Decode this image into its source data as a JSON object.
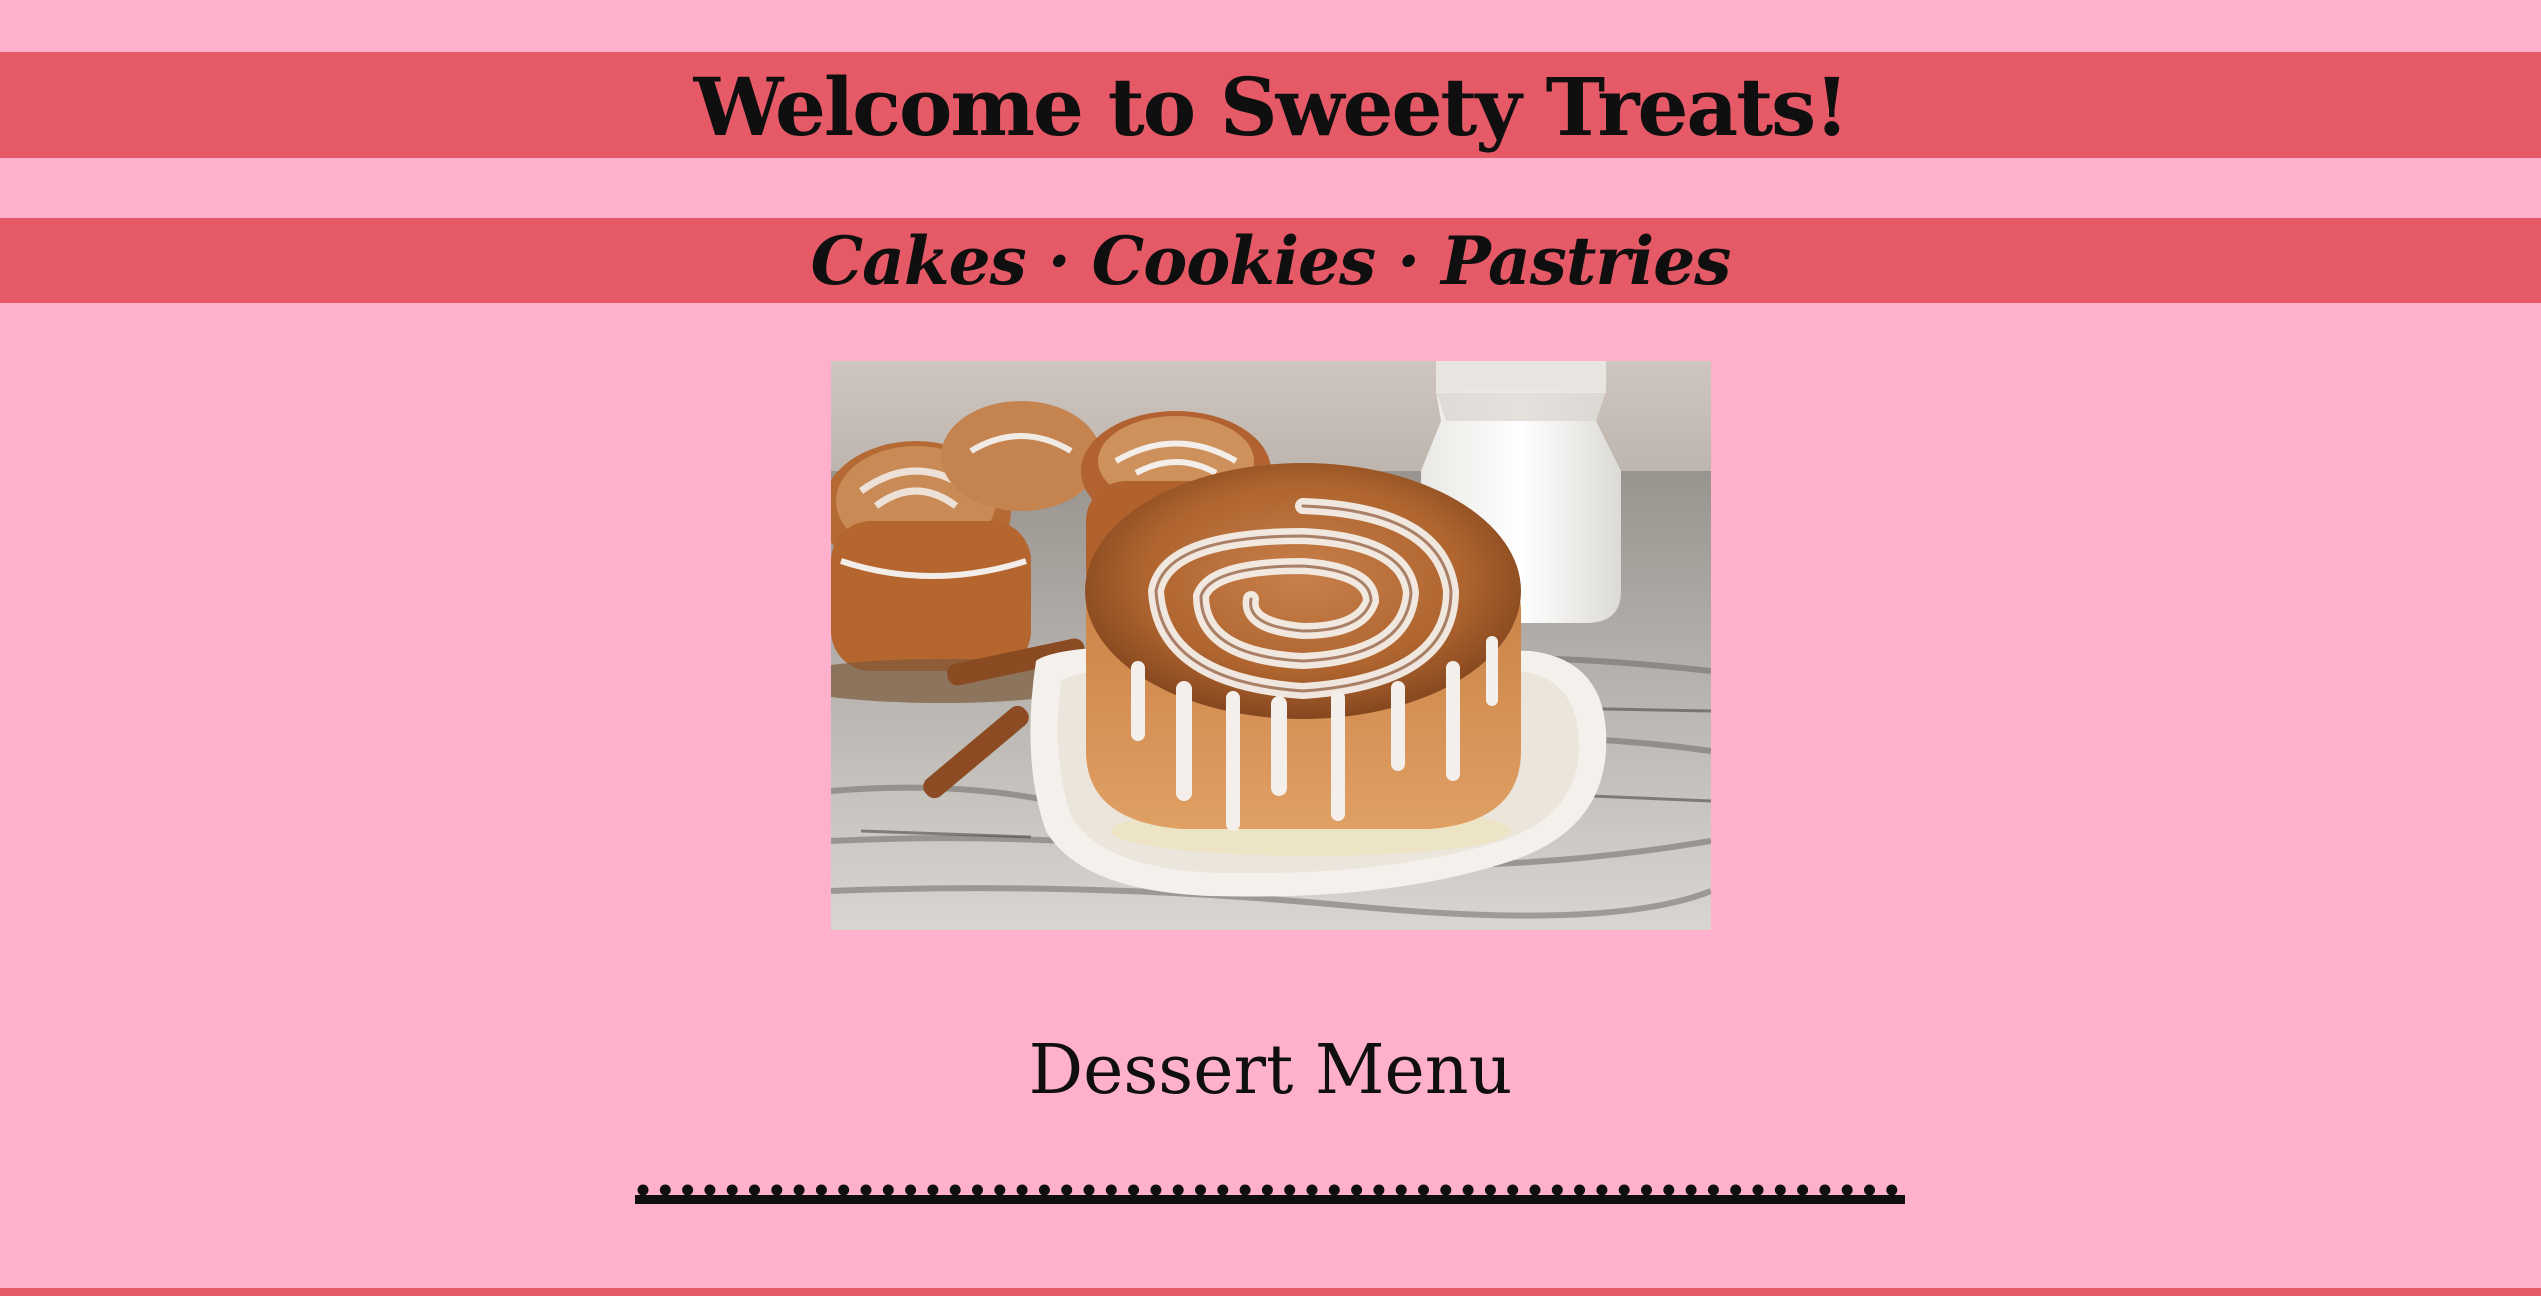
{
  "header": {
    "title": "Welcome to Sweety Treats!",
    "tagline": "Cakes · Cookies · Pastries"
  },
  "hero": {
    "image_subject": "cinnamon-roll-photo"
  },
  "menu": {
    "heading": "Dessert Menu"
  },
  "colors": {
    "page_background": "#ffb0cc",
    "banner": "#e65a67",
    "text": "#0f0f0f"
  }
}
